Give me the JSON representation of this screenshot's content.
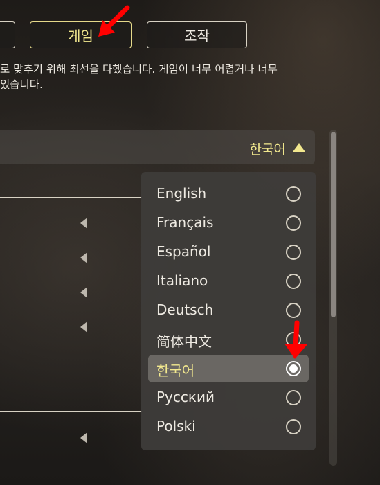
{
  "tabs": [
    {
      "label": ""
    },
    {
      "label": "게임"
    },
    {
      "label": "조작"
    }
  ],
  "description": {
    "line1": "로 맞추기 위해 최선을 다했습니다. 게임이 너무 어렵거나 너무",
    "line2": "있습니다."
  },
  "language_setting": {
    "selected_value": "한국어",
    "caret": "caret-up-icon"
  },
  "dropdown": {
    "options": [
      {
        "label": "English",
        "selected": false
      },
      {
        "label": "Français",
        "selected": false
      },
      {
        "label": "Español",
        "selected": false
      },
      {
        "label": "Italiano",
        "selected": false
      },
      {
        "label": "Deutsch",
        "selected": false
      },
      {
        "label": "简体中文",
        "selected": false
      },
      {
        "label": "한국어",
        "selected": true
      },
      {
        "label": "Русский",
        "selected": false
      },
      {
        "label": "Polski",
        "selected": false
      }
    ]
  },
  "colors": {
    "accent_yellow": "#f2e88e",
    "annotation_red": "#ff0000",
    "dropdown_bg": "#3e3c3a",
    "selected_row_bg": "#6a6763"
  }
}
